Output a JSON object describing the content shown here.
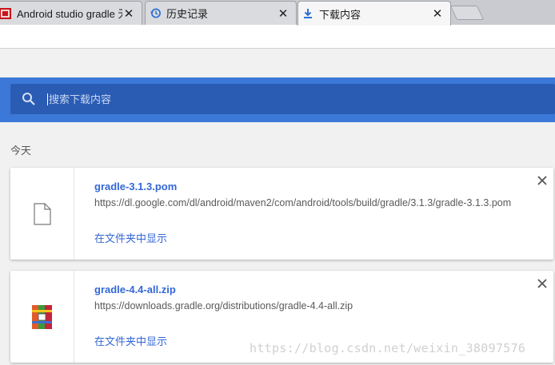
{
  "tabs": [
    {
      "title": "Android studio gradle 无",
      "icon": "csdn-logo-icon"
    },
    {
      "title": "历史记录",
      "icon": "history-icon"
    },
    {
      "title": "下载内容",
      "icon": "download-icon",
      "active": true
    }
  ],
  "search": {
    "placeholder": "搜索下载内容"
  },
  "day_label": "今天",
  "downloads": [
    {
      "filename": "gradle-3.1.3.pom",
      "url": "https://dl.google.com/dl/android/maven2/com/android/tools/build/gradle/3.1.3/gradle-3.1.3.pom",
      "show_in_folder": "在文件夹中显示",
      "icon": "file-icon"
    },
    {
      "filename": "gradle-4.4-all.zip",
      "url": "https://downloads.gradle.org/distributions/gradle-4.4-all.zip",
      "show_in_folder": "在文件夹中显示",
      "icon": "winrar-archive-icon"
    }
  ],
  "watermark": "https://blog.csdn.net/weixin_38097576",
  "colors": {
    "header": "#3c78d8",
    "search": "#2b5cb4",
    "link": "#3367d6"
  }
}
